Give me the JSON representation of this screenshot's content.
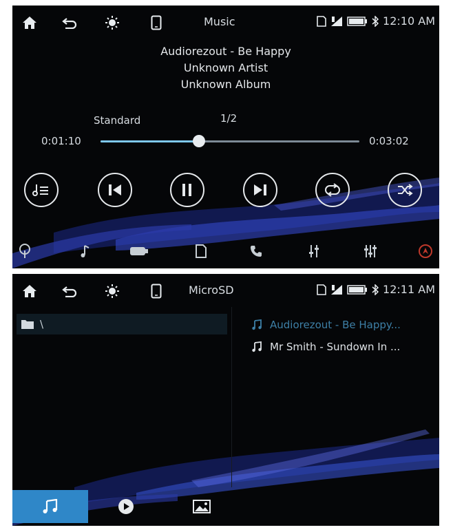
{
  "screen1": {
    "title": "Music",
    "time": "12:10 AM",
    "track": {
      "title": "Audiorezout - Be Happy",
      "artist": "Unknown Artist",
      "album": "Unknown Album"
    },
    "eq_mode": "Standard",
    "track_index": "1/2",
    "elapsed": "0:01:10",
    "duration": "0:03:02",
    "progress_fraction": 0.38
  },
  "screen2": {
    "title": "MicroSD",
    "time": "12:11 AM",
    "folder_path": "\\",
    "files": [
      {
        "name": "Audiorezout - Be Happy...",
        "selected": true
      },
      {
        "name": "Mr Smith - Sundown In ...",
        "selected": false
      }
    ]
  },
  "colors": {
    "accent": "#7ec8f2",
    "selected_file": "#3d7fa6",
    "tab_active": "#2f87c8",
    "wave": "#2d3fb8"
  },
  "icons": {
    "status_left": [
      "home-icon",
      "back-icon",
      "brightness-icon",
      "phone-screen-icon"
    ],
    "status_right": [
      "sd-card-icon",
      "signal-icon",
      "battery-icon",
      "bluetooth-icon"
    ],
    "controls": [
      "playlist-icon",
      "previous-icon",
      "pause-icon",
      "next-icon",
      "repeat-icon",
      "shuffle-icon"
    ],
    "bottom_nav": [
      "radio-icon",
      "music-note-icon",
      "usb-icon",
      "sd-icon",
      "phone-call-icon",
      "equalizer-icon",
      "settings-sliders-icon",
      "navigation-icon"
    ],
    "source_tabs": [
      "music-tab-icon",
      "video-tab-icon",
      "photo-tab-icon"
    ]
  }
}
